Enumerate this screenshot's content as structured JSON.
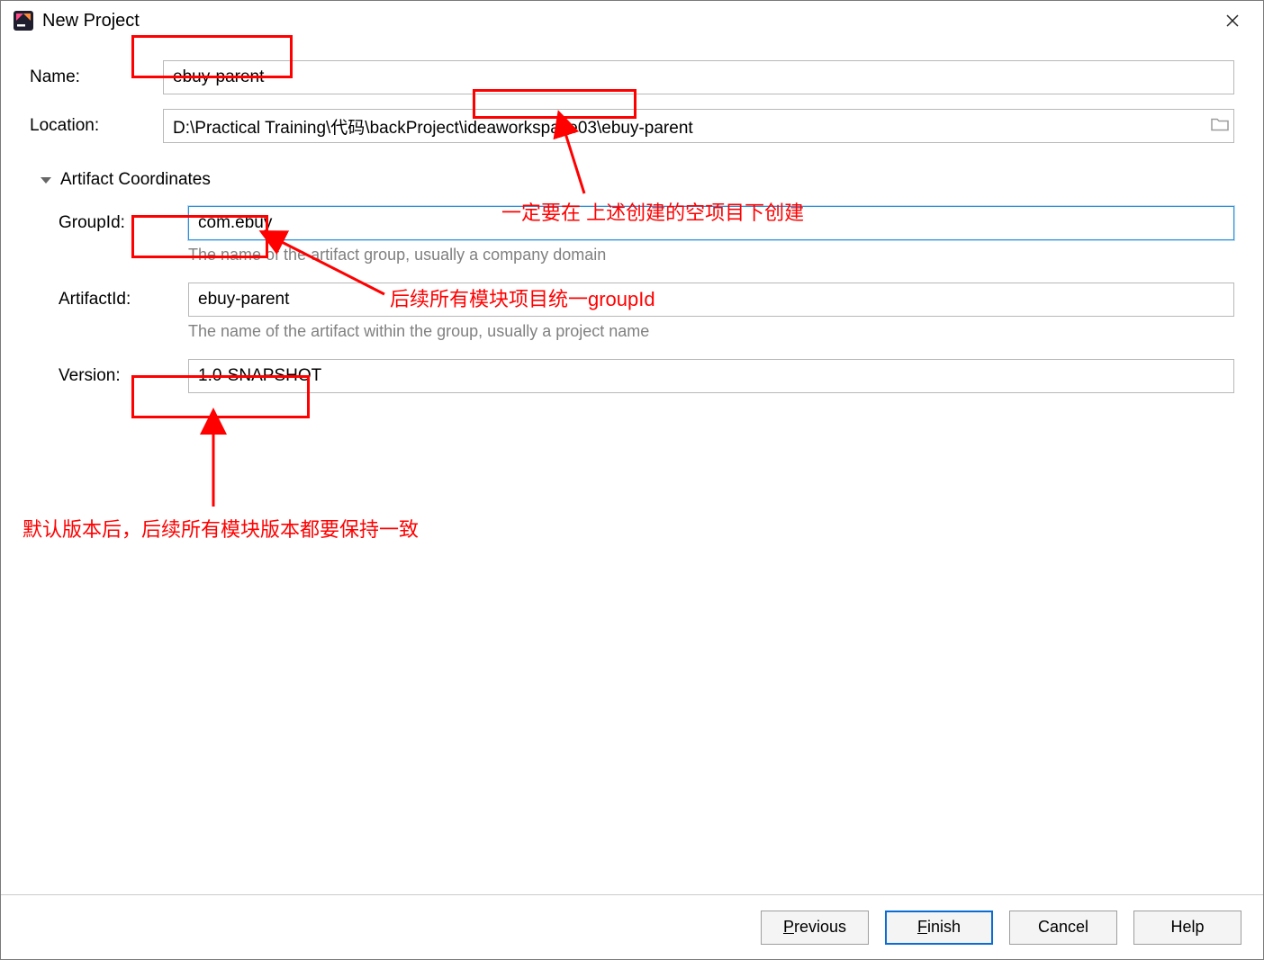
{
  "window": {
    "title": "New Project"
  },
  "form": {
    "name_label": "Name:",
    "name_value": "ebuy-parent",
    "location_label": "Location:",
    "location_value": "D:\\Practical Training\\代码\\backProject\\ideaworkspace03\\ebuy-parent"
  },
  "section": {
    "title": "Artifact Coordinates"
  },
  "artifact": {
    "groupid_label": "GroupId:",
    "groupid_value": "com.ebuy",
    "groupid_hint": "The name of the artifact group, usually a company domain",
    "artifactid_label": "ArtifactId:",
    "artifactid_value": "ebuy-parent",
    "artifactid_hint": "The name of the artifact within the group, usually a project name",
    "version_label": "Version:",
    "version_value": "1.0-SNAPSHOT"
  },
  "annotations": {
    "note1": "一定要在 上述创建的空项目下创建",
    "note2": "后续所有模块项目统一groupId",
    "note3": "默认版本后，后续所有模块版本都要保持一致"
  },
  "buttons": {
    "previous": "Previous",
    "finish": "Finish",
    "cancel": "Cancel",
    "help": "Help"
  }
}
